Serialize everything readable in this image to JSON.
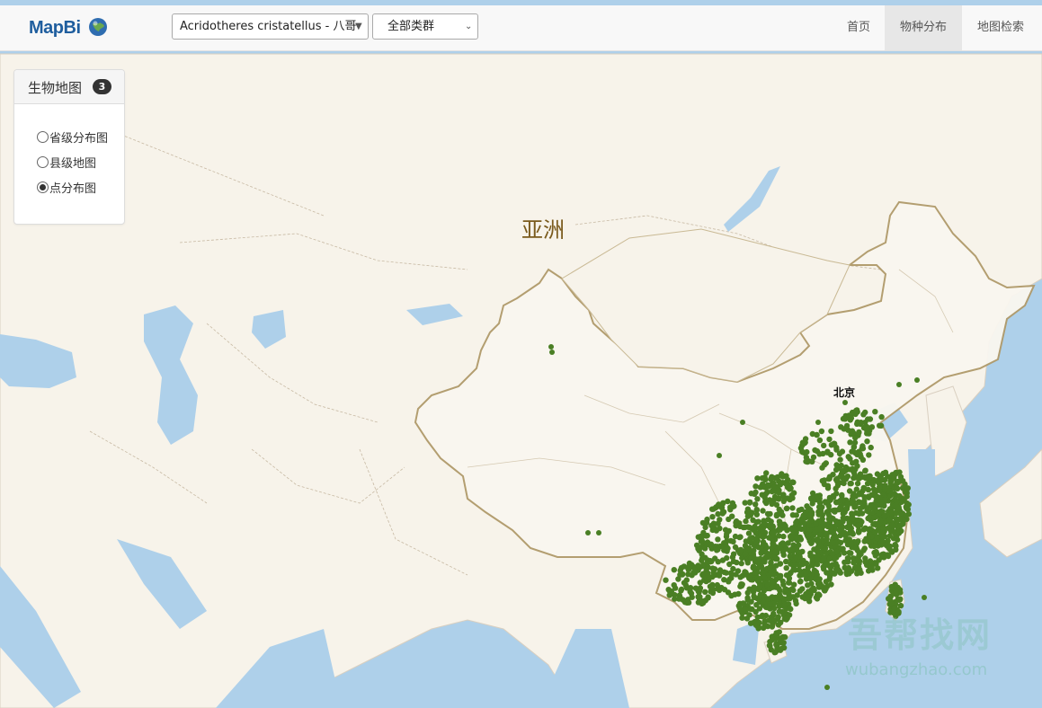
{
  "app": {
    "brand": "MapBi",
    "brand_icon": "globe-icon"
  },
  "toolbar": {
    "species_select": "Acridotheres cristatellus - 八哥",
    "group_select": "全部类群"
  },
  "nav": [
    {
      "label": "首页",
      "active": false
    },
    {
      "label": "物种分布",
      "active": true
    },
    {
      "label": "地图检索",
      "active": false
    }
  ],
  "panel": {
    "title": "生物地图",
    "badge": "3",
    "options": [
      {
        "label": "省级分布图",
        "checked": false
      },
      {
        "label": "县级地图",
        "checked": false
      },
      {
        "label": "点分布图",
        "checked": true
      }
    ]
  },
  "map": {
    "continent_label": "亚洲",
    "city_label": "北京",
    "point_color": "#4a7f24",
    "land_color": "#f7f3ea",
    "water_color": "#aed0ea"
  },
  "watermark": {
    "text": "吾帮找网",
    "url": "wubangzhao.com"
  }
}
